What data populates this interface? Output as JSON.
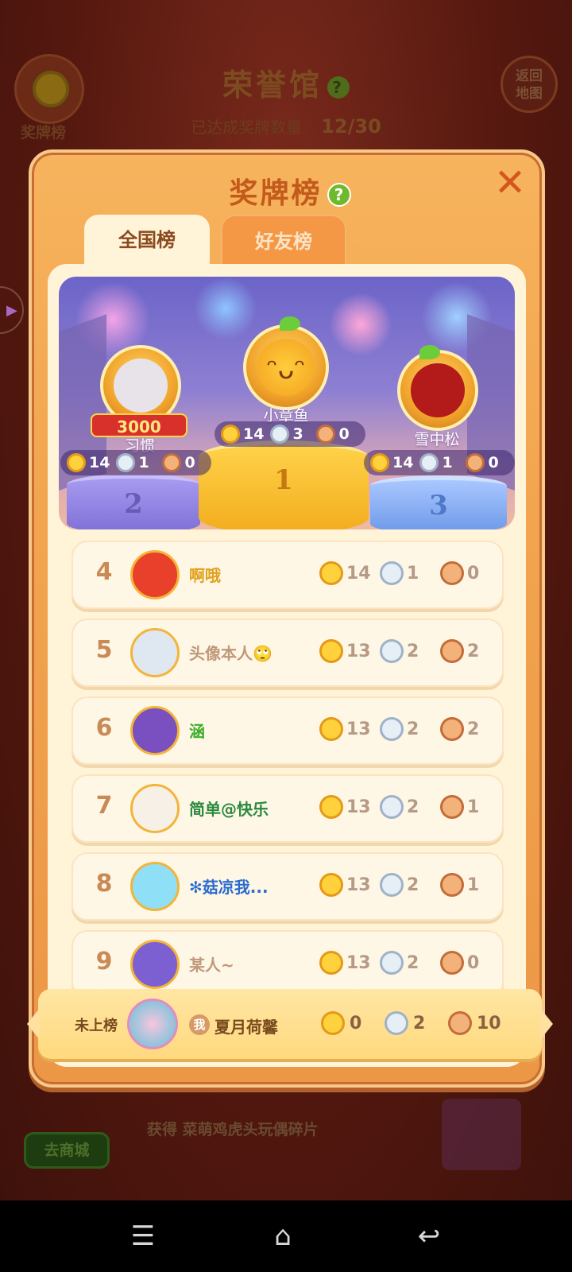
{
  "background": {
    "title": "荣誉馆",
    "progress_label": "已达成奖牌数量",
    "progress_value": "12/30",
    "medal_board_label": "奖牌榜",
    "return_label_line1": "返回",
    "return_label_line2": "地图",
    "shop_button": "去商城",
    "reward_text": "获得 菜萌鸡虎头玩偶碎片"
  },
  "modal": {
    "title": "奖牌榜",
    "help": "?",
    "close": "✕",
    "tabs": [
      {
        "label": "全国榜",
        "active": true
      },
      {
        "label": "好友榜",
        "active": false
      }
    ]
  },
  "podium": {
    "first": {
      "rank": "1",
      "name": "小章鱼",
      "gold": "14",
      "silver": "3",
      "bronze": "0"
    },
    "second": {
      "rank": "2",
      "name": "习惯",
      "badge": "3000",
      "gold": "14",
      "silver": "1",
      "bronze": "0"
    },
    "third": {
      "rank": "3",
      "name": "雪中松",
      "gold": "14",
      "silver": "1",
      "bronze": "0"
    }
  },
  "rows": [
    {
      "rank": "4",
      "name": "啊哦",
      "name_color": "#e0a21e",
      "gold": "14",
      "silver": "1",
      "bronze": "0"
    },
    {
      "rank": "5",
      "name": "头像本人🙄",
      "name_color": "#c0987a",
      "gold": "13",
      "silver": "2",
      "bronze": "2"
    },
    {
      "rank": "6",
      "name": "涵",
      "name_color": "#3fae2a",
      "gold": "13",
      "silver": "2",
      "bronze": "2"
    },
    {
      "rank": "7",
      "name": "简单@快乐",
      "name_color": "#2a8a3e",
      "gold": "13",
      "silver": "2",
      "bronze": "1"
    },
    {
      "rank": "8",
      "name": "✻菇凉我...",
      "name_color": "#2a6bd0",
      "gold": "13",
      "silver": "2",
      "bronze": "1"
    },
    {
      "rank": "9",
      "name": "某人~",
      "name_color": "#c0987a",
      "gold": "13",
      "silver": "2",
      "bronze": "0"
    }
  ],
  "me": {
    "status": "未上榜",
    "badge": "我",
    "name": "夏月荷馨",
    "gold": "0",
    "silver": "2",
    "bronze": "10"
  },
  "colors": {
    "panel": "#f2a44e",
    "title": "#c25a1b",
    "rank": "#c98a55"
  },
  "nav": {
    "menu": "☰",
    "home": "⌂",
    "back": "↩"
  }
}
